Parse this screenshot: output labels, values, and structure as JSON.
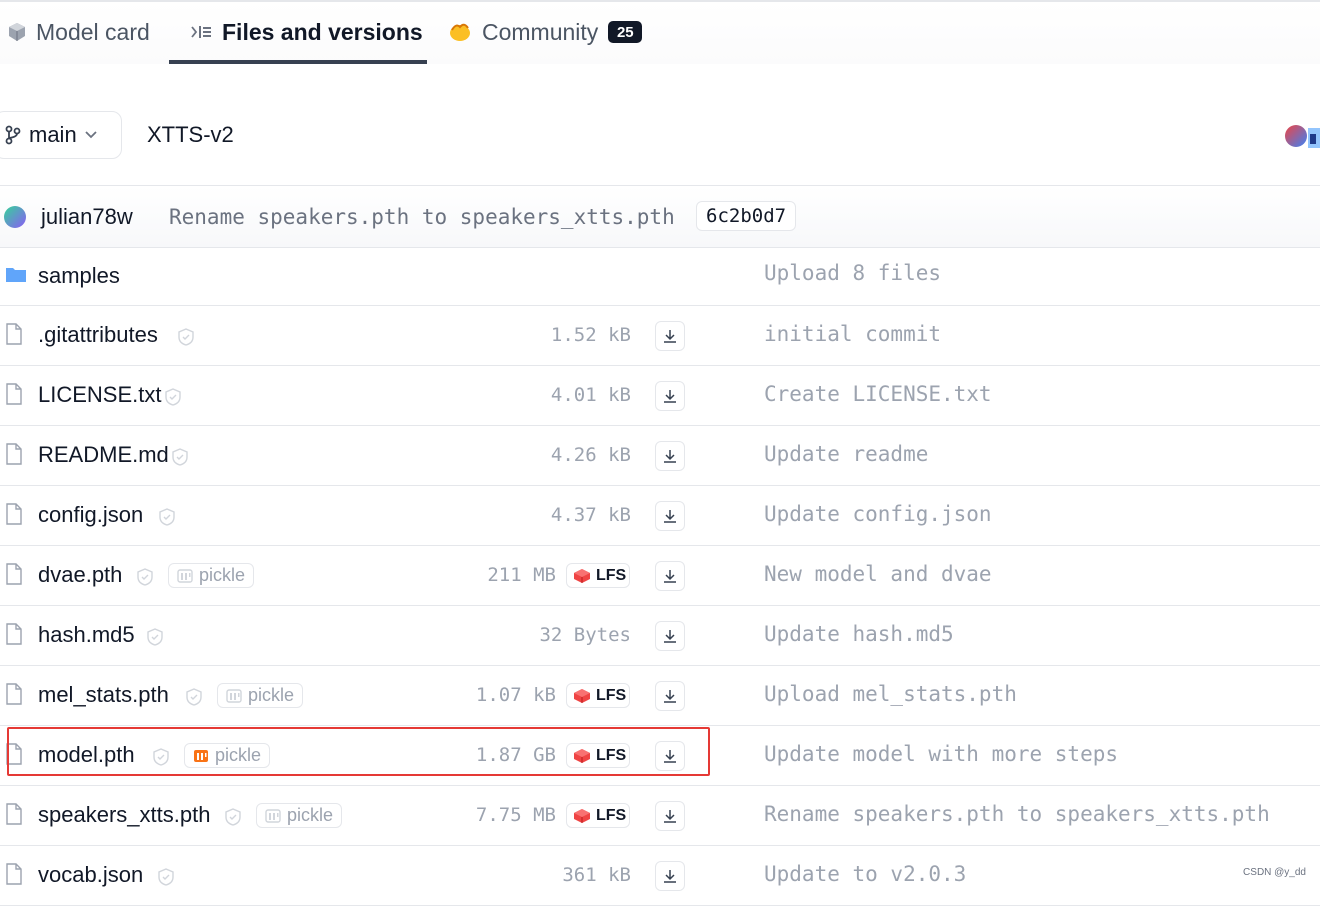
{
  "tabs": [
    {
      "label": "Model card",
      "icon": "cube-icon"
    },
    {
      "label": "Files and versions",
      "icon": "files-icon",
      "active": true
    },
    {
      "label": "Community",
      "icon": "hand-wave-icon",
      "count": "25"
    }
  ],
  "repo": {
    "branch": "main",
    "name": "XTTS-v2"
  },
  "commit": {
    "author": "julian78w",
    "message": "Rename speakers.pth to speakers_xtts.pth",
    "hash": "6c2b0d7"
  },
  "files": [
    {
      "name": "samples",
      "type": "folder",
      "size": "",
      "lfs": false,
      "pickle": false,
      "commit": "Upload 8 files"
    },
    {
      "name": ".gitattributes",
      "type": "file",
      "size": "1.52 kB",
      "lfs": false,
      "pickle": false,
      "commit": "initial commit"
    },
    {
      "name": "LICENSE.txt",
      "type": "file",
      "size": "4.01 kB",
      "lfs": false,
      "pickle": false,
      "commit": "Create LICENSE.txt"
    },
    {
      "name": "README.md",
      "type": "file",
      "size": "4.26 kB",
      "lfs": false,
      "pickle": false,
      "commit": "Update readme"
    },
    {
      "name": "config.json",
      "type": "file",
      "size": "4.37 kB",
      "lfs": false,
      "pickle": false,
      "commit": "Update config.json"
    },
    {
      "name": "dvae.pth",
      "type": "file",
      "size": "211 MB",
      "lfs": true,
      "pickle": true,
      "pickle_warning": false,
      "commit": "New model and dvae"
    },
    {
      "name": "hash.md5",
      "type": "file",
      "size": "32 Bytes",
      "lfs": false,
      "pickle": false,
      "commit": "Update hash.md5"
    },
    {
      "name": "mel_stats.pth",
      "type": "file",
      "size": "1.07 kB",
      "lfs": true,
      "pickle": true,
      "pickle_warning": false,
      "commit": "Upload mel_stats.pth"
    },
    {
      "name": "model.pth",
      "type": "file",
      "size": "1.87 GB",
      "lfs": true,
      "pickle": true,
      "pickle_warning": true,
      "commit": "Update model with more steps"
    },
    {
      "name": "speakers_xtts.pth",
      "type": "file",
      "size": "7.75 MB",
      "lfs": true,
      "pickle": true,
      "pickle_warning": false,
      "commit": "Rename speakers.pth to speakers_xtts.pth"
    },
    {
      "name": "vocab.json",
      "type": "file",
      "size": "361 kB",
      "lfs": false,
      "pickle": false,
      "commit": "Update to v2.0.3"
    }
  ],
  "labels": {
    "lfs": "LFS",
    "pickle": "pickle"
  },
  "watermark": "CSDN @y_dd",
  "colors": {
    "folder": "#60a5fa",
    "highlight": "#e53935",
    "lfs_icon": "#ef4444",
    "pickle_warning": "#f97316"
  }
}
